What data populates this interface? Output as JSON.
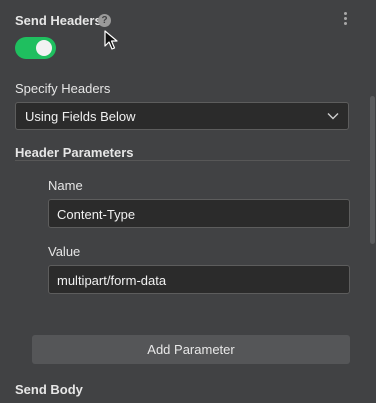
{
  "send_headers": {
    "label": "Send Headers",
    "help_icon": "question-circle-icon",
    "help_glyph": "?",
    "menu_icon": "vertical-ellipsis-icon",
    "toggle_on": true,
    "toggle_color": "#1fbf5f"
  },
  "specify_headers": {
    "label": "Specify Headers",
    "selected": "Using Fields Below",
    "chevron_icon": "chevron-down-icon"
  },
  "header_parameters": {
    "title": "Header Parameters",
    "fields": [
      {
        "label": "Name",
        "value": "Content-Type"
      },
      {
        "label": "Value",
        "value": "multipart/form-data"
      }
    ],
    "add_button_label": "Add Parameter"
  },
  "send_body": {
    "label": "Send Body"
  },
  "colors": {
    "background": "#414244",
    "input_background": "#2b2b2b",
    "button_background": "#555658",
    "toggle_on": "#1fbf5f"
  }
}
